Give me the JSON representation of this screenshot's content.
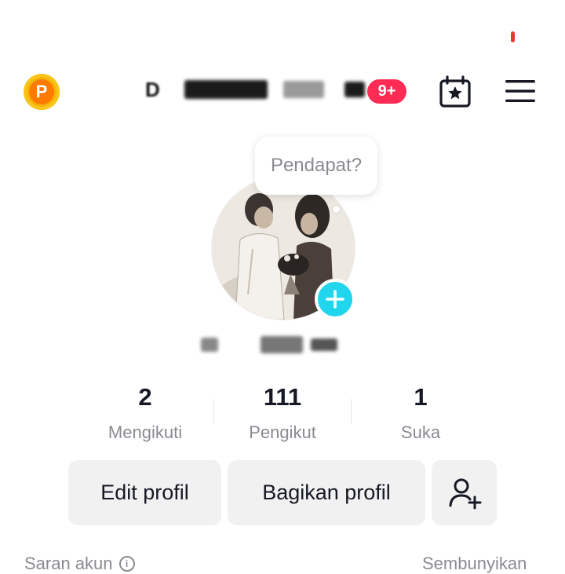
{
  "header": {
    "coin_letter": "P",
    "notifications_badge": "9+"
  },
  "profile": {
    "tooltip": "Pendapat?"
  },
  "stats": [
    {
      "value": "2",
      "label": "Mengikuti"
    },
    {
      "value": "111",
      "label": "Pengikut"
    },
    {
      "value": "1",
      "label": "Suka"
    }
  ],
  "actions": {
    "edit_label": "Edit profil",
    "share_label": "Bagikan profil"
  },
  "suggestions": {
    "title": "Saran akun",
    "hide_label": "Sembunyikan"
  },
  "icons": {
    "coin": "coin-icon",
    "calendar": "calendar-star-icon",
    "menu": "hamburger-menu-icon",
    "add_avatar": "plus-icon",
    "add_friend": "add-user-icon",
    "info": "info-icon"
  },
  "colors": {
    "badge": "#fe2c55",
    "add_avatar": "#20d5ec",
    "coin": "#f6b400",
    "button_bg": "#f1f1f2",
    "muted_text": "#8a8b91"
  }
}
